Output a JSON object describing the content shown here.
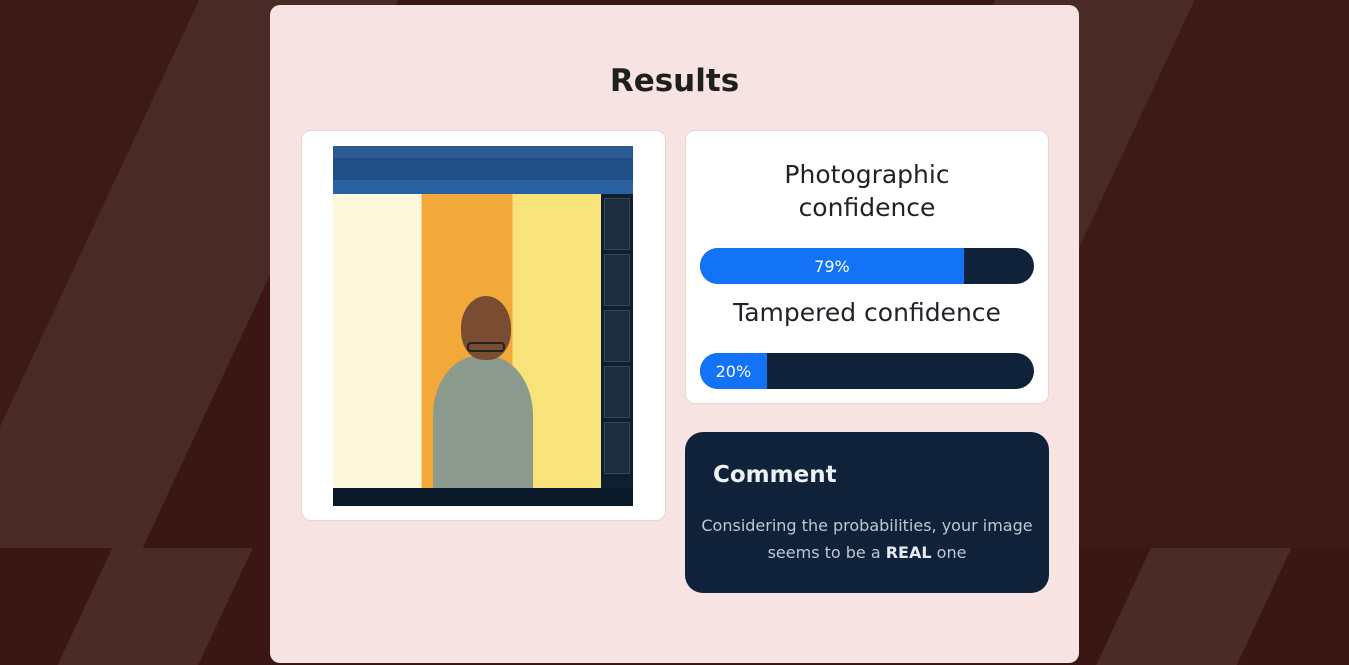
{
  "page": {
    "title": "Results"
  },
  "image_card": {
    "image_alt": "Uploaded image: screenshot of a video call with a person in glasses"
  },
  "confidence": {
    "photographic": {
      "label": "Photographic confidence",
      "value_text": "79%",
      "value": 0.79
    },
    "tampered": {
      "label": "Tampered confidence",
      "value_text": "20%",
      "value": 0.2
    }
  },
  "comment": {
    "title": "Comment",
    "text_before": "Considering the probabilities,  your image seems to be a ",
    "verdict": "REAL",
    "text_after": " one"
  },
  "colors": {
    "background": "#3a1714",
    "panel": "#f6e3e2",
    "bar_track": "#0f2239",
    "bar_fill": "#1273f6",
    "comment_bg": "#0f2239"
  }
}
